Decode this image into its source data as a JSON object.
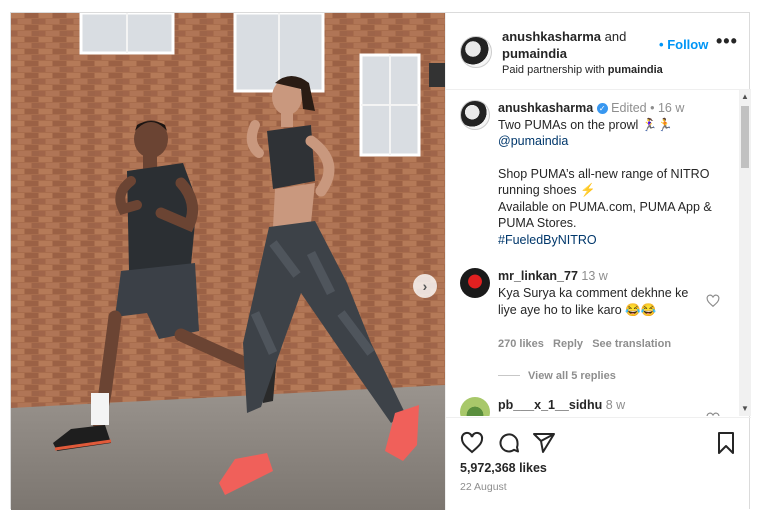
{
  "header": {
    "username": "anushkasharma",
    "and_text": "and",
    "coauthor": "pumaindia",
    "follow_dot": "•",
    "follow_label": "Follow",
    "more": "•••",
    "partnership_prefix": "Paid partnership with",
    "partnership_brand": "pumaindia"
  },
  "caption": {
    "username": "anushkasharma",
    "edited": "Edited",
    "dot": "•",
    "age": "16 w",
    "line1": "Two PUMAs on the prowl 🏃‍♀️🏃",
    "mention": "@pumaindia",
    "line3": "Shop PUMA’s all-new range of NITRO running shoes ⚡",
    "line4": "Available on PUMA.com, PUMA App & PUMA Stores.",
    "hashtag": "#FueledByNITRO"
  },
  "comments": [
    {
      "username": "mr_linkan_77",
      "age": "13 w",
      "text": "Kya Surya ka comment dekhne ke liye aye ho to like karo 😂😂",
      "likes": "270 likes",
      "reply": "Reply",
      "translate": "See translation",
      "view_replies": "View all 5 replies"
    },
    {
      "username": "pb___x_1__sidhu",
      "age": "8 w",
      "text": "❤"
    }
  ],
  "footer": {
    "likes": "5,972,368 likes",
    "date": "22 August"
  },
  "carousel": {
    "next": "›"
  },
  "icons": [
    "heart-icon",
    "comment-icon",
    "share-icon",
    "bookmark-icon",
    "more-icon",
    "verified-icon",
    "chevron-right-icon"
  ]
}
